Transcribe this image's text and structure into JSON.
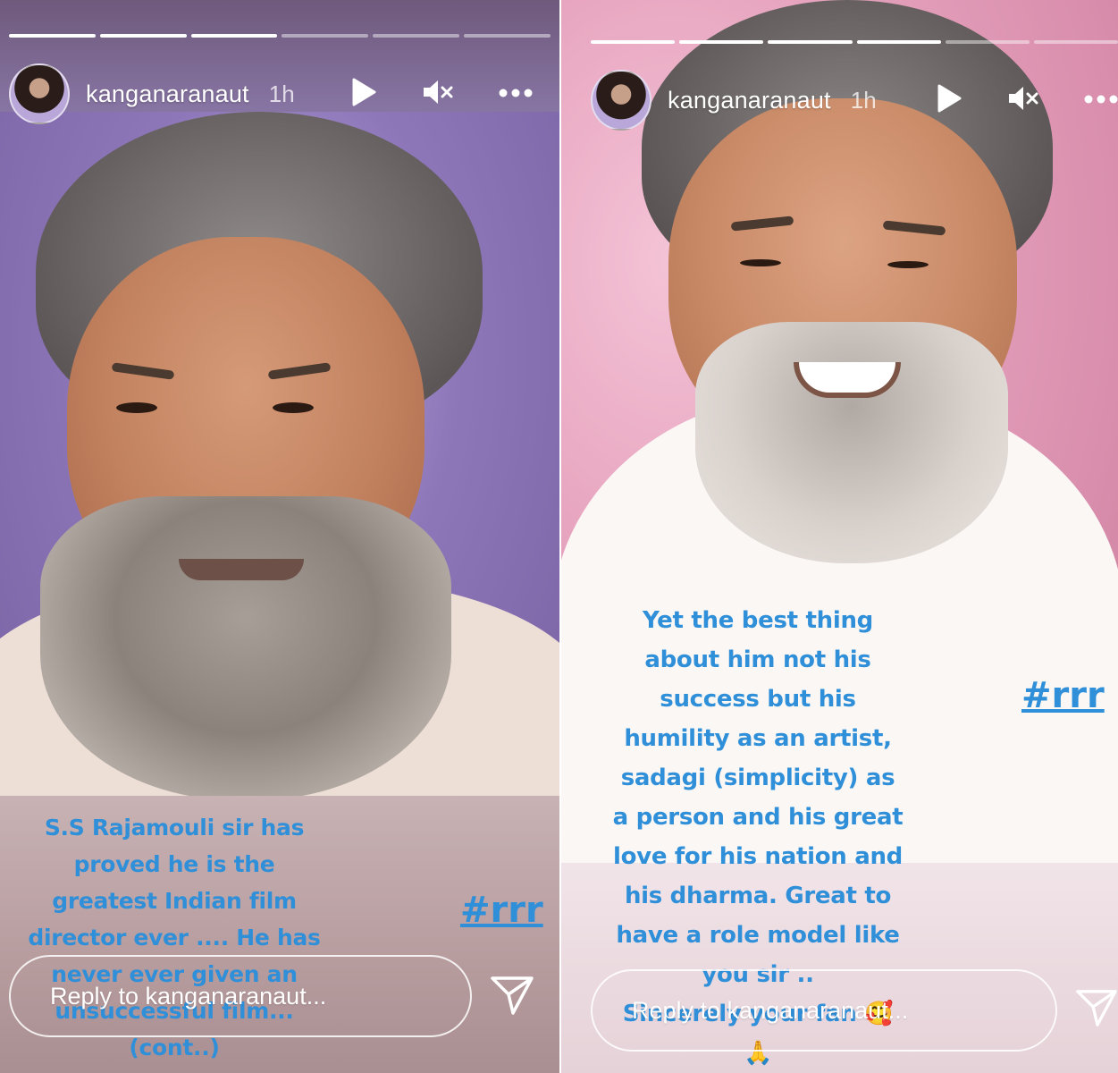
{
  "stories": [
    {
      "username": "kanganaranaut",
      "time": "1h",
      "progress": {
        "segments": 6,
        "completed": 3
      },
      "caption_lines": [
        "S.S Rajamouli sir has",
        "proved he is the",
        "greatest Indian film",
        "director ever .... He has",
        "never ever given an",
        "unsuccessful film...",
        "(cont..)"
      ],
      "hashtag": "#rrr",
      "reply_placeholder": "Reply to kanganaranaut..."
    },
    {
      "username": "kanganaranaut",
      "time": "1h",
      "progress": {
        "segments": 6,
        "completed": 4
      },
      "caption_lines": [
        "Yet the best thing",
        "about him not his",
        "success but his",
        "humility as an artist,",
        "sadagi (simplicity) as",
        "a person and his great",
        "love for his nation and",
        "his dharma. Great to",
        "have a role model like",
        "you  sir ..",
        "Sincerely your fan 🥰",
        "🙏"
      ],
      "hashtag": "#rrr",
      "reply_placeholder": "Reply to kanganaranaut..."
    }
  ],
  "icons": [
    "play-icon",
    "mute-icon",
    "more-icon",
    "send-icon"
  ],
  "colors": {
    "caption": "#2f8fd8",
    "ui_text": "#ffffff"
  }
}
